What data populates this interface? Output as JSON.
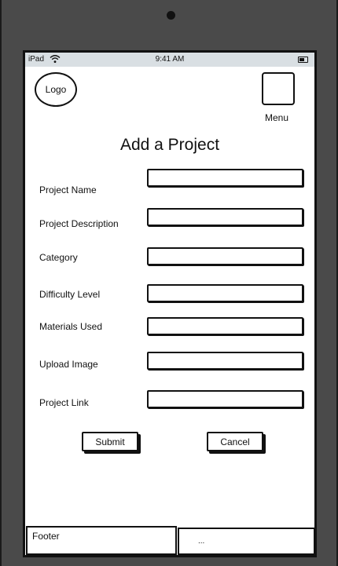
{
  "status_bar": {
    "carrier": "iPad",
    "time": "9:41 AM",
    "wifi_icon": "wifi-icon",
    "battery_icon": "battery-icon"
  },
  "header": {
    "logo_text": "Logo",
    "menu_label": "Menu"
  },
  "page": {
    "title": "Add a Project"
  },
  "form": {
    "fields": [
      {
        "label": "Project Name",
        "value": ""
      },
      {
        "label": "Project Description",
        "value": ""
      },
      {
        "label": "Category",
        "value": ""
      },
      {
        "label": "Difficulty Level",
        "value": ""
      },
      {
        "label": "Materials Used",
        "value": ""
      },
      {
        "label": "Upload Image",
        "value": ""
      },
      {
        "label": "Project Link",
        "value": ""
      }
    ],
    "submit_label": "Submit",
    "cancel_label": "Cancel"
  },
  "footer": {
    "left_text": "Footer",
    "right_text": "..."
  },
  "colors": {
    "device_frame": "#4a4a4a",
    "status_bar": "#d9dfe3",
    "ink": "#111111"
  }
}
